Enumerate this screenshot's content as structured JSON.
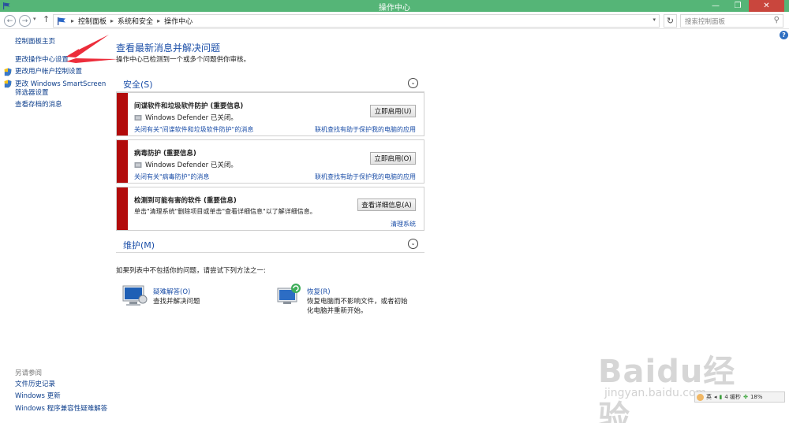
{
  "window": {
    "title": "操作中心"
  },
  "address": {
    "crumbs": [
      "控制面板",
      "系统和安全",
      "操作中心"
    ],
    "search_placeholder": "搜索控制面板"
  },
  "sidebar": {
    "links": [
      "控制面板主页",
      "更改操作中心设置",
      "更改用户帐户控制设置",
      "更改 Windows SmartScreen",
      "筛选器设置",
      "查看存档的消息"
    ],
    "see_also_title": "另请参阅",
    "see_also": [
      "文件历史记录",
      "Windows 更新",
      "Windows 程序兼容性疑难解答"
    ]
  },
  "main": {
    "title": "查看最新消息并解决问题",
    "subtitle": "操作中心已检测到一个或多个问题供你审核。",
    "security_label": "安全(S)",
    "maintenance_label": "维护(M)",
    "panels": [
      {
        "title": "间谍软件和垃圾软件防护  (重要信息)",
        "status": "Windows Defender 已关闭。",
        "button": "立即启用(U)",
        "link_left": "关闭有关\"间谍软件和垃圾软件防护\"的消息",
        "link_right": "联机查找有助于保护我的电脑的应用"
      },
      {
        "title": "病毒防护  (重要信息)",
        "status": "Windows Defender 已关闭。",
        "button": "立即启用(O)",
        "link_left": "关闭有关\"病毒防护\"的消息",
        "link_right": "联机查找有助于保护我的电脑的应用"
      },
      {
        "title": "检测到可能有害的软件  (重要信息)",
        "desc": "单击\"清理系统\"删除项目或单击\"查看详细信息\"以了解详细信息。",
        "button": "查看详细信息(A)",
        "link_right": "清理系统"
      }
    ],
    "note": "如果列表中不包括你的问题，请尝试下列方法之一:",
    "tools": [
      {
        "title": "疑难解答(O)",
        "desc": "查找并解决问题"
      },
      {
        "title": "恢复(R)",
        "desc_line1": "恢复电脑而不影响文件，或者初始",
        "desc_line2": "化电脑并重新开始。"
      }
    ]
  },
  "watermark": {
    "brand": "Baidu经验",
    "url": "jingyan.baidu.com"
  },
  "imebar": {
    "text1": "英",
    "text2": "4 缓秒",
    "battery": "18%"
  },
  "colors": {
    "titlebar": "#55b577",
    "alert": "#b20b0b",
    "link": "#1c4fa8"
  }
}
